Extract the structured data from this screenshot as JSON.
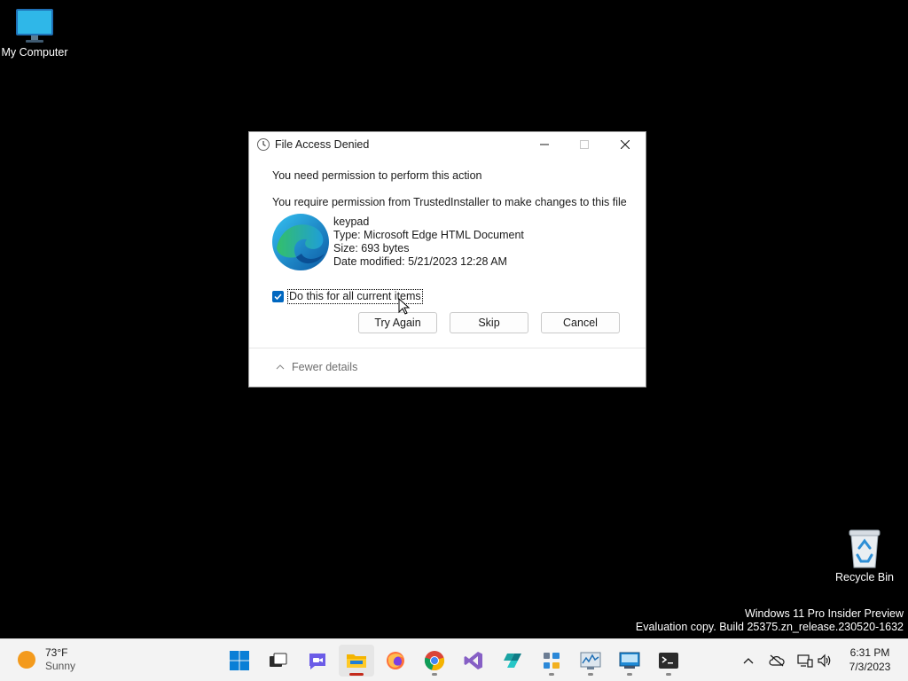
{
  "desktop": {
    "icons": [
      {
        "label": "My Computer"
      },
      {
        "label": "Recycle Bin"
      }
    ],
    "watermark": {
      "line1": "Windows 11 Pro Insider Preview",
      "line2": "Evaluation copy. Build 25375.zn_release.230520-1632"
    }
  },
  "dialog": {
    "title": "File Access Denied",
    "message": "You need permission to perform this action",
    "detail": "You require permission from TrustedInstaller to make changes to this file",
    "file": {
      "name": "keypad",
      "type": "Type: Microsoft Edge HTML Document",
      "size": "Size: 693 bytes",
      "modified": "Date modified: 5/21/2023 12:28 AM"
    },
    "checkbox": {
      "label": "Do this for all current items",
      "checked": true
    },
    "buttons": {
      "try_again": "Try Again",
      "skip": "Skip",
      "cancel": "Cancel"
    },
    "fewer_details": "Fewer details"
  },
  "taskbar": {
    "weather": {
      "temp": "73°F",
      "condition": "Sunny"
    },
    "apps": [
      "start-icon",
      "task-view-icon",
      "chat-icon",
      "file-explorer-icon",
      "firefox-icon",
      "chrome-icon",
      "visual-studio-icon",
      "app-icon",
      "network-tool-icon",
      "resource-monitor-icon",
      "remote-desktop-icon",
      "terminal-icon"
    ],
    "clock": {
      "time": "6:31 PM",
      "date": "7/3/2023"
    }
  },
  "colors": {
    "accent": "#0067c0",
    "active_indicator": "#c42b1c"
  }
}
